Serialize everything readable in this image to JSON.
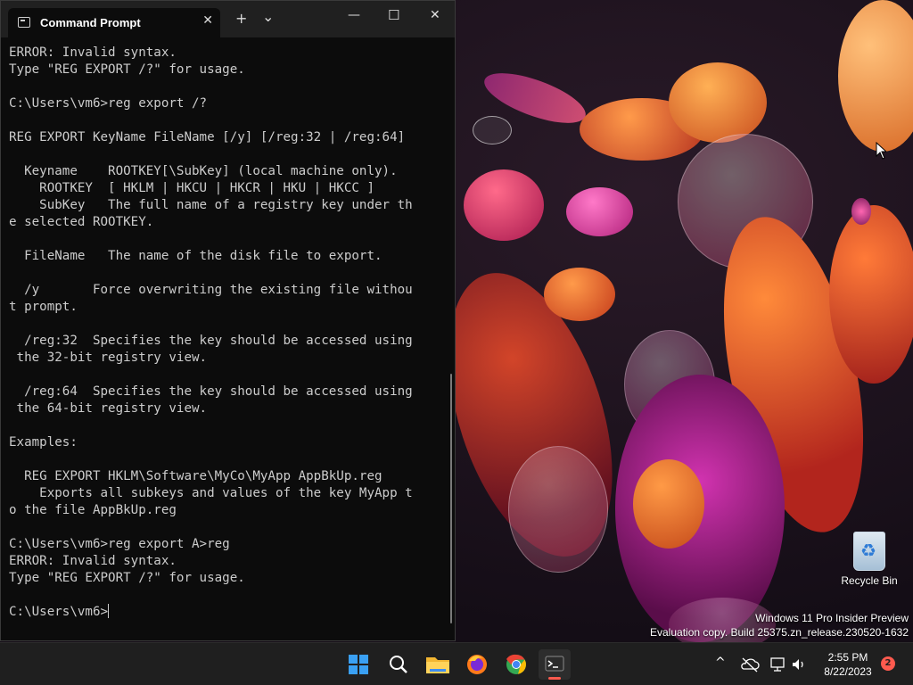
{
  "window": {
    "tab_title": "Command Prompt",
    "tab_icon": "console-icon",
    "close_tab_glyph": "✕",
    "new_tab_glyph": "+",
    "dropdown_glyph": "⌄",
    "minimize_glyph": "—",
    "maximize_glyph": "☐",
    "close_glyph": "✕"
  },
  "console": {
    "lines": [
      "ERROR: Invalid syntax.",
      "Type \"REG EXPORT /?\" for usage.",
      "",
      "C:\\Users\\vm6>reg export /?",
      "",
      "REG EXPORT KeyName FileName [/y] [/reg:32 | /reg:64]",
      "",
      "  Keyname    ROOTKEY[\\SubKey] (local machine only).",
      "    ROOTKEY  [ HKLM | HKCU | HKCR | HKU | HKCC ]",
      "    SubKey   The full name of a registry key under th",
      "e selected ROOTKEY.",
      "",
      "  FileName   The name of the disk file to export.",
      "",
      "  /y       Force overwriting the existing file withou",
      "t prompt.",
      "",
      "  /reg:32  Specifies the key should be accessed using",
      " the 32-bit registry view.",
      "",
      "  /reg:64  Specifies the key should be accessed using",
      " the 64-bit registry view.",
      "",
      "Examples:",
      "",
      "  REG EXPORT HKLM\\Software\\MyCo\\MyApp AppBkUp.reg",
      "    Exports all subkeys and values of the key MyApp t",
      "o the file AppBkUp.reg",
      "",
      "C:\\Users\\vm6>reg export A>reg",
      "ERROR: Invalid syntax.",
      "Type \"REG EXPORT /?\" for usage.",
      ""
    ],
    "prompt": "C:\\Users\\vm6>"
  },
  "desktop": {
    "recycle_bin_label": "Recycle Bin",
    "watermark_line1": "Windows 11 Pro Insider Preview",
    "watermark_line2": "Evaluation copy. Build 25375.zn_release.230520-1632"
  },
  "taskbar": {
    "apps": [
      {
        "name": "start-button",
        "icon": "windows-logo-icon"
      },
      {
        "name": "search-button",
        "icon": "search-icon"
      },
      {
        "name": "file-explorer-button",
        "icon": "folder-icon"
      },
      {
        "name": "firefox-button",
        "icon": "firefox-icon"
      },
      {
        "name": "chrome-button",
        "icon": "chrome-icon"
      },
      {
        "name": "terminal-button",
        "icon": "terminal-icon",
        "active": true
      }
    ],
    "tray_chevron": "^",
    "time": "2:55 PM",
    "date": "8/22/2023",
    "notification_count": "2",
    "accent_color": "#ff5a4e"
  }
}
